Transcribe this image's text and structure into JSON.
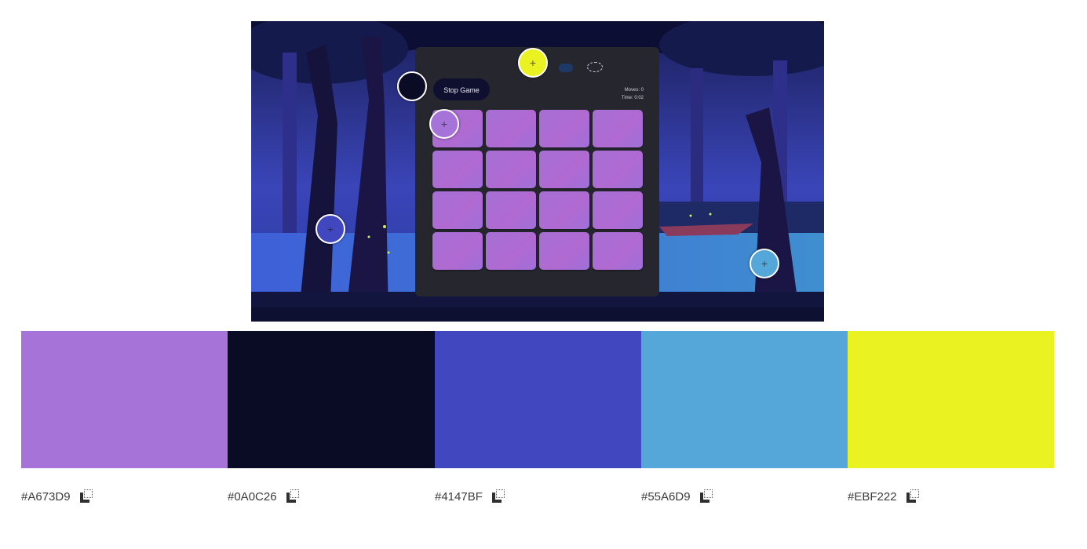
{
  "game": {
    "stop_label": "Stop Game",
    "moves_label": "Moves: 0",
    "time_label": "Time: 0:02",
    "card_count": 16
  },
  "palette": [
    {
      "hex": "#A673D9",
      "color": "#A673D9"
    },
    {
      "hex": "#0A0C26",
      "color": "#0A0C26"
    },
    {
      "hex": "#4147BF",
      "color": "#4147BF"
    },
    {
      "hex": "#55A6D9",
      "color": "#55A6D9"
    },
    {
      "hex": "#EBF222",
      "color": "#EBF222"
    }
  ],
  "icons": {
    "copy": "copy-icon",
    "picker": "plus-crosshair-icon"
  }
}
